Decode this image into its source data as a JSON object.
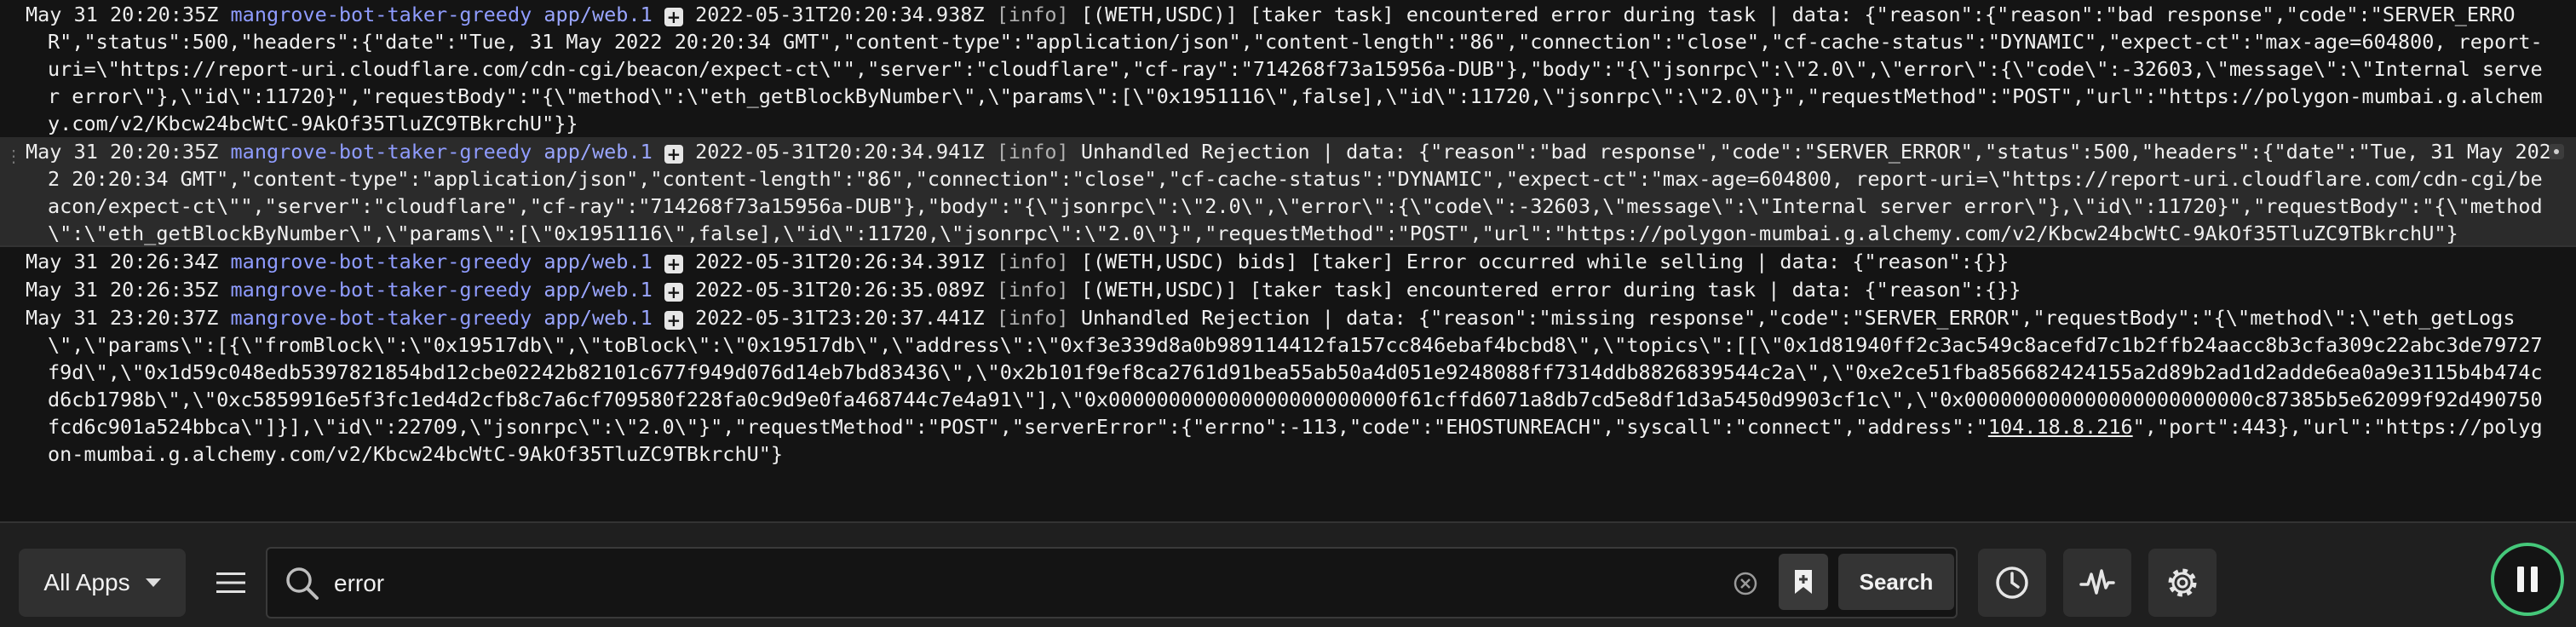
{
  "logs": [
    {
      "time": "May 31 20:20:35Z",
      "app": "mangrove-bot-taker-greedy",
      "proc": "app/web.1",
      "ts2": "2022-05-31T20:20:34.938Z",
      "level": "[info]",
      "text": "[(WETH,USDC)] [taker task] encountered error during task | data: {\"reason\":{\"reason\":\"bad response\",\"code\":\"SERVER_ERROR\",\"status\":500,\"headers\":{\"date\":\"Tue, 31 May 2022 20:20:34 GMT\",\"content-type\":\"application/json\",\"content-length\":\"86\",\"connection\":\"close\",\"cf-cache-status\":\"DYNAMIC\",\"expect-ct\":\"max-age=604800, report-uri=\\\"https://report-uri.cloudflare.com/cdn-cgi/beacon/expect-ct\\\"\",\"server\":\"cloudflare\",\"cf-ray\":\"714268f73a15956a-DUB\"},\"body\":\"{\\\"jsonrpc\\\":\\\"2.0\\\",\\\"error\\\":{\\\"code\\\":-32603,\\\"message\\\":\\\"Internal server error\\\"},\\\"id\\\":11720}\",\"requestBody\":\"{\\\"method\\\":\\\"eth_getBlockByNumber\\\",\\\"params\\\":[\\\"0x1951116\\\",false],\\\"id\\\":11720,\\\"jsonrpc\\\":\\\"2.0\\\"}\",\"requestMethod\":\"POST\",\"url\":\"https://polygon-mumbai.g.alchemy.com/v2/Kbcw24bcWtC-9AkOf35TluZC9TBkrchU\"}}"
    },
    {
      "time": "May 31 20:20:35Z",
      "app": "mangrove-bot-taker-greedy",
      "proc": "app/web.1",
      "ts2": "2022-05-31T20:20:34.941Z",
      "level": "[info]",
      "text": "Unhandled Rejection | data: {\"reason\":\"bad response\",\"code\":\"SERVER_ERROR\",\"status\":500,\"headers\":{\"date\":\"Tue, 31 May 2022 20:20:34 GMT\",\"content-type\":\"application/json\",\"content-length\":\"86\",\"connection\":\"close\",\"cf-cache-status\":\"DYNAMIC\",\"expect-ct\":\"max-age=604800, report-uri=\\\"https://report-uri.cloudflare.com/cdn-cgi/beacon/expect-ct\\\"\",\"server\":\"cloudflare\",\"cf-ray\":\"714268f73a15956a-DUB\"},\"body\":\"{\\\"jsonrpc\\\":\\\"2.0\\\",\\\"error\\\":{\\\"code\\\":-32603,\\\"message\\\":\\\"Internal server error\\\"},\\\"id\\\":11720}\",\"requestBody\":\"{\\\"method\\\":\\\"eth_getBlockByNumber\\\",\\\"params\\\":[\\\"0x1951116\\\",false],\\\"id\\\":11720,\\\"jsonrpc\\\":\\\"2.0\\\"}\",\"requestMethod\":\"POST\",\"url\":\"https://polygon-mumbai.g.alchemy.com/v2/Kbcw24bcWtC-9AkOf35TluZC9TBkrchU\"}"
    },
    {
      "time": "May 31 20:26:34Z",
      "app": "mangrove-bot-taker-greedy",
      "proc": "app/web.1",
      "ts2": "2022-05-31T20:26:34.391Z",
      "level": "[info]",
      "text": "[(WETH,USDC) bids] [taker] Error occurred while selling | data: {\"reason\":{}}"
    },
    {
      "time": "May 31 20:26:35Z",
      "app": "mangrove-bot-taker-greedy",
      "proc": "app/web.1",
      "ts2": "2022-05-31T20:26:35.089Z",
      "level": "[info]",
      "text": "[(WETH,USDC)] [taker task] encountered error during task | data: {\"reason\":{}}"
    },
    {
      "time": "May 31 23:20:37Z",
      "app": "mangrove-bot-taker-greedy",
      "proc": "app/web.1",
      "ts2": "2022-05-31T23:20:37.441Z",
      "level": "[info]",
      "text": "Unhandled Rejection | data: {\"reason\":\"missing response\",\"code\":\"SERVER_ERROR\",\"requestBody\":\"{\\\"method\\\":\\\"eth_getLogs\\\",\\\"params\\\":[{\\\"fromBlock\\\":\\\"0x19517db\\\",\\\"toBlock\\\":\\\"0x19517db\\\",\\\"address\\\":\\\"0xf3e339d8a0b989114412fa157cc846ebaf4bcbd8\\\",\\\"topics\\\":[[\\\"0x1d81940ff2c3ac549c8acefd7c1b2ffb24aacc8b3cfa309c22abc3de79727f9d\\\",\\\"0x1d59c048edb5397821854bd12cbe02242b82101c677f949d076d14eb7bd83436\\\",\\\"0x2b101f9ef8ca2761d91bea55ab50a4d051e9248088ff7314ddb8826839544c2a\\\",\\\"0xe2ce51fba856682424155a2d89b2ad1d2adde6ea0a9e3115b4b474cd6cb1798b\\\",\\\"0xc5859916e5f3fc1ed4d2cfb8c7a6cf709580f228fa0c9d9e0fa468744c7e4a91\\\"],\\\"0x000000000000000000000000f61cffd6071a8db7cd5e8df1d3a5450d9903cf1c\\\",\\\"0x000000000000000000000000c87385b5e62099f92d490750fcd6c901a524bbca\\\"]}],\\\"id\\\":22709,\\\"jsonrpc\\\":\\\"2.0\\\"}\",\"requestMethod\":\"POST\",\"serverError\":{\"errno\":-113,\"code\":\"EHOSTUNREACH\",\"syscall\":\"connect\",\"address\":\"",
      "ip": "104.18.8.216",
      "text_after": "\",\"port\":443},\"url\":\"https://polygon-mumbai.g.alchemy.com/v2/Kbcw24bcWtC-9AkOf35TluZC9TBkrchU\"}"
    }
  ],
  "toolbar": {
    "apps_label": "All Apps",
    "search_value": "error",
    "search_button": "Search",
    "icons": [
      "chevron-down-icon",
      "menu-icon",
      "search-icon",
      "clear-icon",
      "bookmark-icon",
      "history-icon",
      "pulse-icon",
      "gear-icon",
      "pause-icon"
    ]
  },
  "colors": {
    "app_name": "#8f9cff",
    "pause_ring": "#45c87a",
    "highlight_row": "#2b2b2b"
  }
}
